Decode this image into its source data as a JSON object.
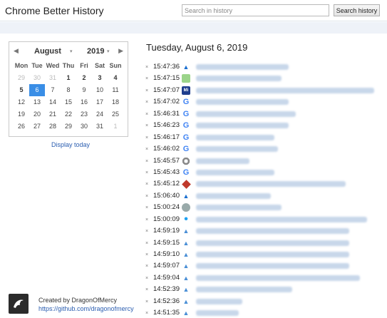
{
  "header": {
    "app_title": "Chrome Better History",
    "search_placeholder": "Search in history",
    "search_button": "Search history"
  },
  "calendar": {
    "prev_icon": "◀",
    "next_icon": "▶",
    "month": "August",
    "year": "2019",
    "caret": "▾",
    "weekdays": [
      "Mon",
      "Tue",
      "Wed",
      "Thu",
      "Fri",
      "Sat",
      "Sun"
    ],
    "selected_day": "6",
    "display_today": "Display today"
  },
  "main": {
    "date_heading": "Tuesday, August 6, 2019",
    "delete_icon": "×"
  },
  "entries": [
    {
      "time": "15:47:36",
      "icon": "wordpress-icon"
    },
    {
      "time": "15:47:15",
      "icon": "green-site-icon"
    },
    {
      "time": "15:47:07",
      "icon": "mi-icon"
    },
    {
      "time": "15:47:02",
      "icon": "google-icon"
    },
    {
      "time": "15:46:31",
      "icon": "google-icon"
    },
    {
      "time": "15:46:23",
      "icon": "google-icon"
    },
    {
      "time": "15:46:17",
      "icon": "google-icon"
    },
    {
      "time": "15:46:02",
      "icon": "google-icon"
    },
    {
      "time": "15:45:57",
      "icon": "chrome-icon"
    },
    {
      "time": "15:45:43",
      "icon": "google-icon"
    },
    {
      "time": "15:45:12",
      "icon": "red-diamond-icon"
    },
    {
      "time": "15:06:40",
      "icon": "wordpress-icon"
    },
    {
      "time": "15:00:24",
      "icon": "gray-site-icon"
    },
    {
      "time": "15:00:09",
      "icon": "twitter-icon"
    },
    {
      "time": "14:59:19",
      "icon": "waterdrop-icon"
    },
    {
      "time": "14:59:15",
      "icon": "waterdrop-icon"
    },
    {
      "time": "14:59:10",
      "icon": "waterdrop-icon"
    },
    {
      "time": "14:59:07",
      "icon": "waterdrop-icon"
    },
    {
      "time": "14:59:04",
      "icon": "waterdrop-icon"
    },
    {
      "time": "14:52:39",
      "icon": "waterdrop-icon"
    },
    {
      "time": "14:52:36",
      "icon": "waterdrop-icon"
    },
    {
      "time": "14:51:35",
      "icon": "waterdrop-icon"
    }
  ],
  "footer": {
    "logo_icon": "dragon-logo-icon",
    "created_by": "Created by DragonOfMercy",
    "github_link": "https://github.com/dragonofmercy"
  }
}
